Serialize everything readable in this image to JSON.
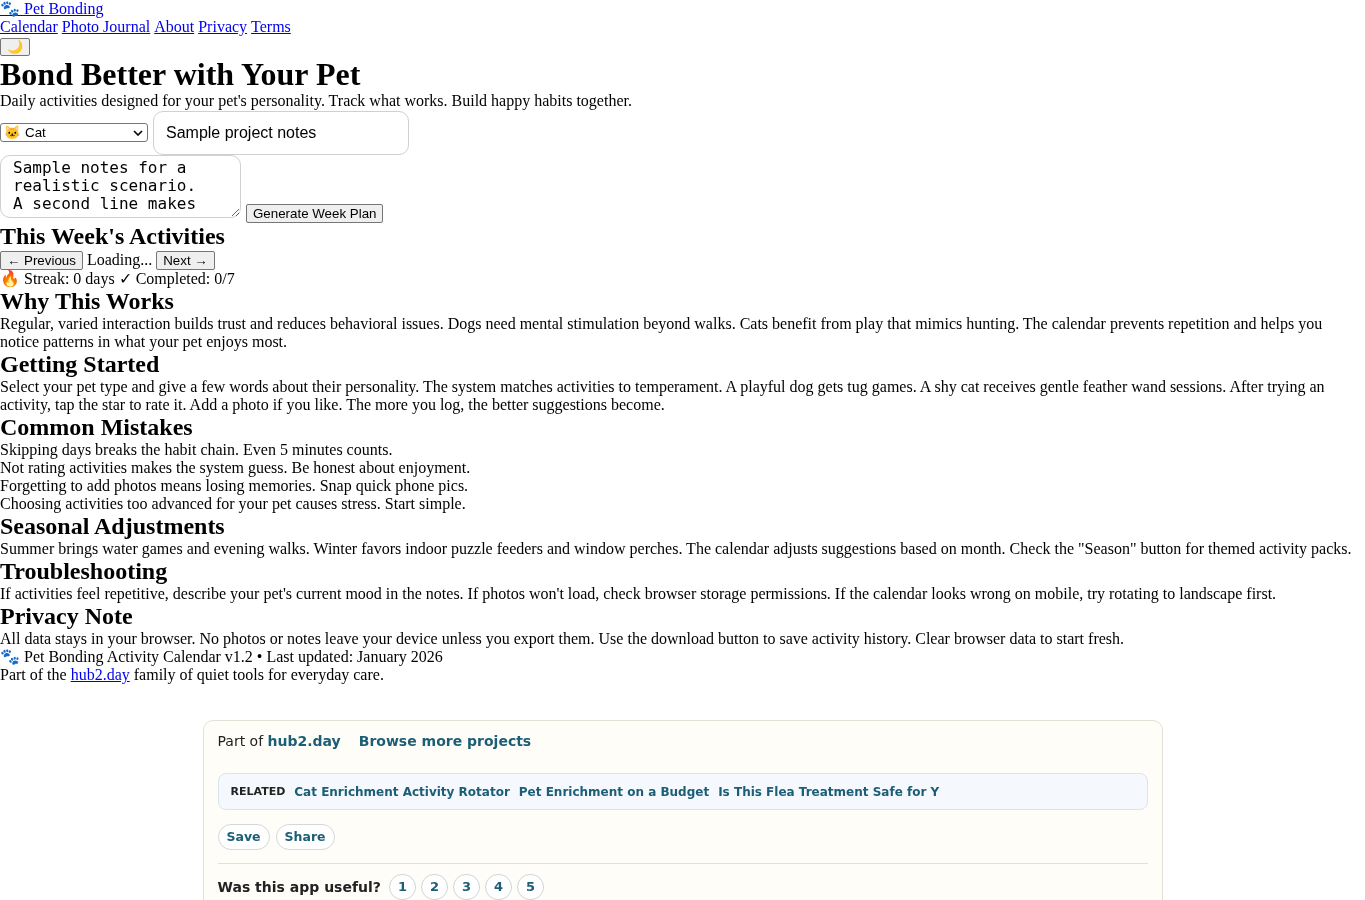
{
  "header": {
    "logo": {
      "icon": "🐾",
      "label": "Pet Bonding"
    },
    "nav": [
      {
        "label": "Calendar"
      },
      {
        "label": "Photo Journal"
      },
      {
        "label": "About"
      },
      {
        "label": "Privacy"
      },
      {
        "label": "Terms"
      }
    ],
    "theme_toggle": {
      "icon": "🌙"
    }
  },
  "hero": {
    "title": "Bond Better with Your Pet",
    "subtitle": "Daily activities designed for your pet's personality. Track what works. Build happy habits together."
  },
  "form": {
    "pet_type": {
      "icon": "🐱",
      "value": "Cat"
    },
    "project_name": {
      "value": "Sample project notes"
    },
    "notes": {
      "value": "Sample notes for a realistic scenario. A second line makes"
    },
    "submit": {
      "label": "Generate Week Plan"
    }
  },
  "week": {
    "title": "This Week's Activities",
    "previous": "← Previous",
    "status": "Loading...",
    "next": "Next →",
    "stats": {
      "streak_icon": "🔥",
      "streak": "Streak: 0 days",
      "completed_icon": "✓",
      "completed": "Completed: 0/7"
    }
  },
  "sections": [
    {
      "title": "Why This Works",
      "paragraphs": [
        "Regular, varied interaction builds trust and reduces behavioral issues. Dogs need mental stimulation beyond walks. Cats benefit from play that mimics hunting. The calendar prevents repetition and helps you notice patterns in what your pet enjoys most."
      ]
    },
    {
      "title": "Getting Started",
      "paragraphs": [
        "Select your pet type and give a few words about their personality. The system matches activities to temperament. A playful dog gets tug games. A shy cat receives gentle feather wand sessions. After trying an activity, tap the star to rate it. Add a photo if you like. The more you log, the better suggestions become."
      ]
    },
    {
      "title": "Common Mistakes",
      "paragraphs": [
        "Skipping days breaks the habit chain. Even 5 minutes counts.",
        "Not rating activities makes the system guess. Be honest about enjoyment.",
        "Forgetting to add photos means losing memories. Snap quick phone pics.",
        "Choosing activities too advanced for your pet causes stress. Start simple."
      ]
    },
    {
      "title": "Seasonal Adjustments",
      "paragraphs": [
        "Summer brings water games and evening walks. Winter favors indoor puzzle feeders and window perches. The calendar adjusts suggestions based on month. Check the \"Season\" button for themed activity packs."
      ]
    },
    {
      "title": "Troubleshooting",
      "paragraphs": [
        "If activities feel repetitive, describe your pet's current mood in the notes. If photos won't load, check browser storage permissions. If the calendar looks wrong on mobile, try rotating to landscape first."
      ]
    },
    {
      "title": "Privacy Note",
      "paragraphs": [
        "All data stays in your browser. No photos or notes leave your device unless you export them. Use the download button to save activity history. Clear browser data to start fresh."
      ]
    }
  ],
  "footer": {
    "icon": "🐾",
    "version": "Pet Bonding Activity Calendar v1.2 • Last updated: January 2026",
    "tagline": {
      "before": "Part of the",
      "link": "hub2.day",
      "after": "family of quiet tools for everyday care."
    }
  },
  "hub_card": {
    "part_of": {
      "label": "Part of",
      "link": "hub2.day"
    },
    "browse": "Browse more projects",
    "related": {
      "label": "RELATED",
      "links": [
        "Cat Enrichment Activity Rotator",
        "Pet Enrichment on a Budget",
        "Is This Flea Treatment Safe for Y"
      ]
    },
    "actions": [
      "Save",
      "Share"
    ],
    "rating": {
      "question": "Was this app useful?",
      "options": [
        {
          "label": "1",
          "selected": false
        },
        {
          "label": "2",
          "selected": false
        },
        {
          "label": "3",
          "selected": false
        },
        {
          "label": "4",
          "selected": false
        },
        {
          "label": "5",
          "selected": false
        }
      ]
    }
  }
}
